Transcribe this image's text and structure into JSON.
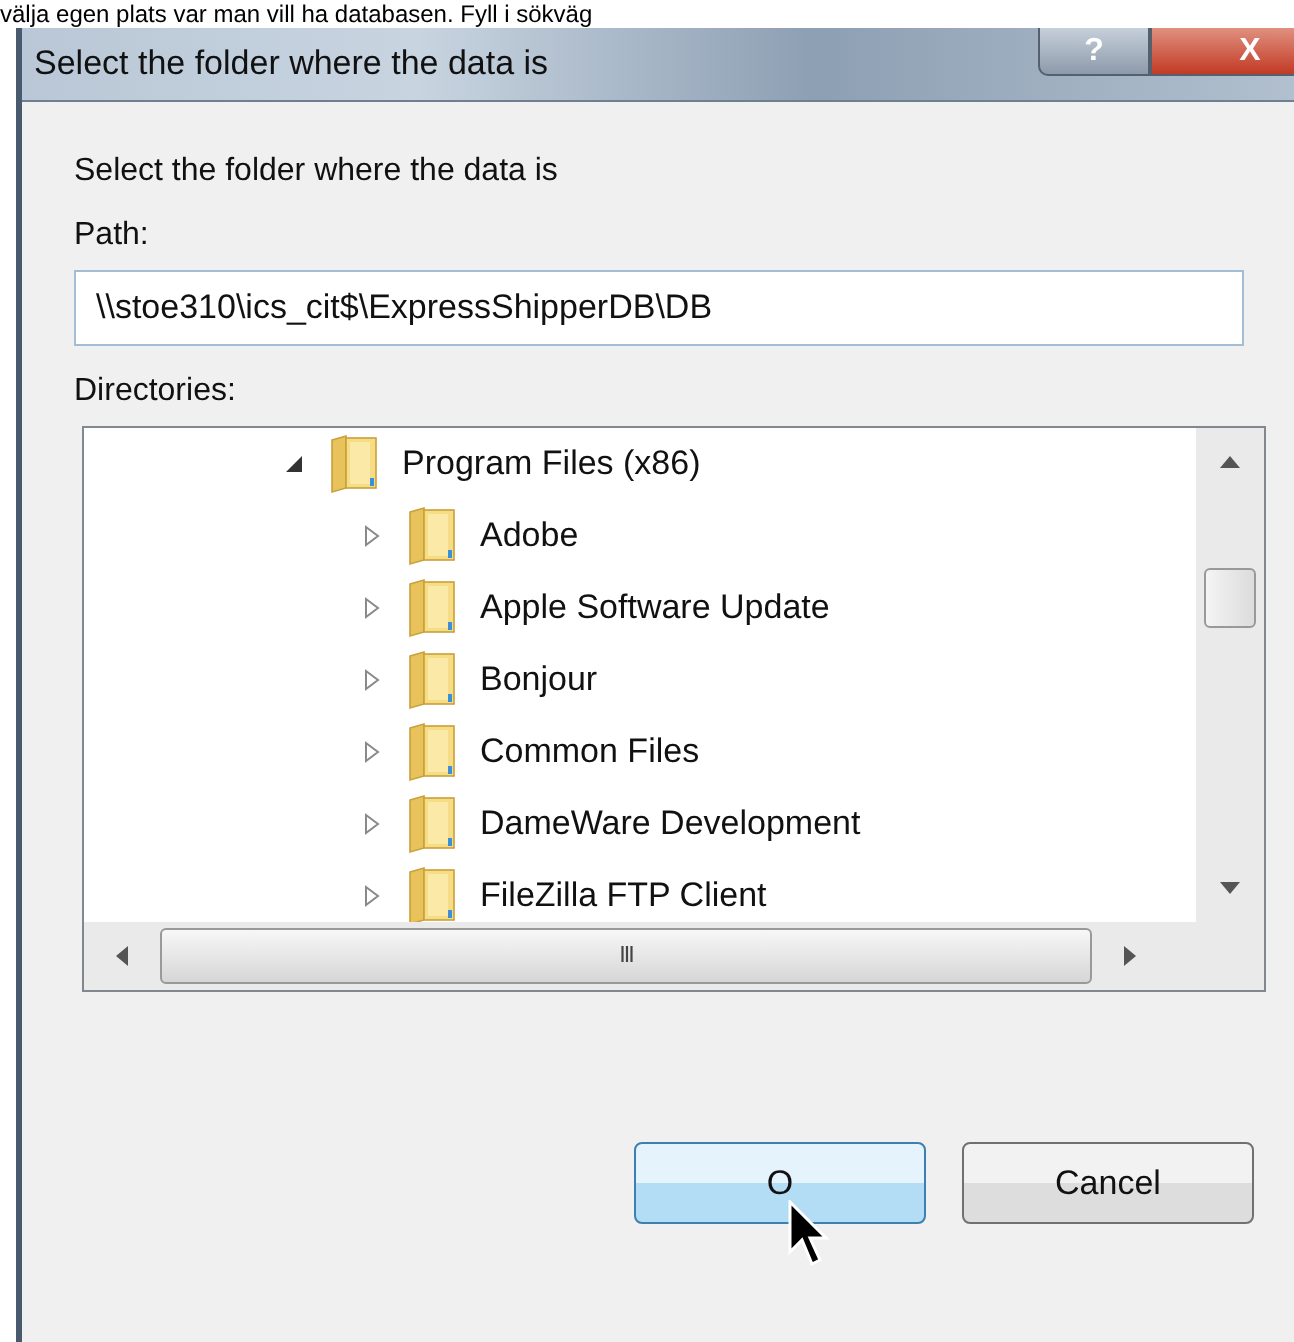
{
  "background_text": "välja egen plats var man vill ha databasen. Fyll i sökväg",
  "window": {
    "title": "Select the folder where the data is",
    "title_buttons": [
      {
        "kind": "help",
        "label": "?"
      },
      {
        "kind": "close",
        "label": "X"
      }
    ]
  },
  "prompt": "Select the folder where the data is",
  "path": {
    "label": "Path:",
    "value": "\\\\stoe310\\ics_cit$\\ExpressShipperDB\\DB"
  },
  "directories": {
    "label": "Directories:",
    "tree": [
      {
        "name": "Program Files (x86)",
        "expanded": true,
        "children": [
          {
            "name": "Adobe",
            "expanded": false
          },
          {
            "name": "Apple Software Update",
            "expanded": false
          },
          {
            "name": "Bonjour",
            "expanded": false
          },
          {
            "name": "Common Files",
            "expanded": false
          },
          {
            "name": "DameWare Development",
            "expanded": false
          },
          {
            "name": "FileZilla FTP Client",
            "expanded": false
          }
        ]
      }
    ],
    "h_scroll_grip": "III"
  },
  "buttons": [
    {
      "label": "O",
      "kind": "default"
    },
    {
      "label": "Cancel",
      "kind": "normal"
    }
  ]
}
